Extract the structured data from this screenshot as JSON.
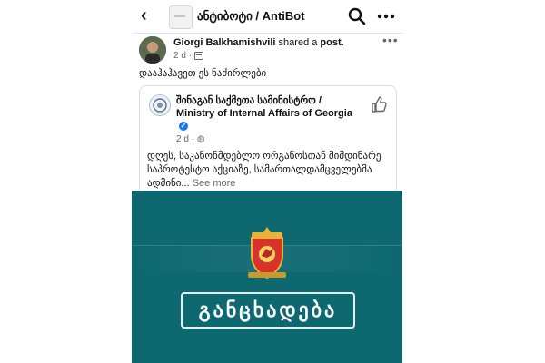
{
  "header": {
    "title": "ანტიბოტი / AntiBot",
    "icons": [
      "back-arrow-icon",
      "search-icon",
      "more-options-icon"
    ]
  },
  "post": {
    "author": "Giorgi Balkhamishvili",
    "action": "shared a",
    "object": "post.",
    "time": "2 d",
    "text": "დააჰაჰავეთ ეს ნაძირლები"
  },
  "shared_post": {
    "page_name": "შინაგან საქმეთა სამინისტრო / Ministry of Internal Affairs of Georgia",
    "time": "2 d",
    "body": "დღეს, საკანონმდებლო ორგანოსთან მიმდინარე საპროტესტო აქციაზე, სამართალდამცველებმა ადმინი...",
    "see_more": "See more"
  },
  "banner": {
    "announcement": "განცხადება"
  },
  "colors": {
    "banner_teal": "#0e6870",
    "verified_blue": "#1877f2",
    "meta_gray": "#65676b"
  }
}
